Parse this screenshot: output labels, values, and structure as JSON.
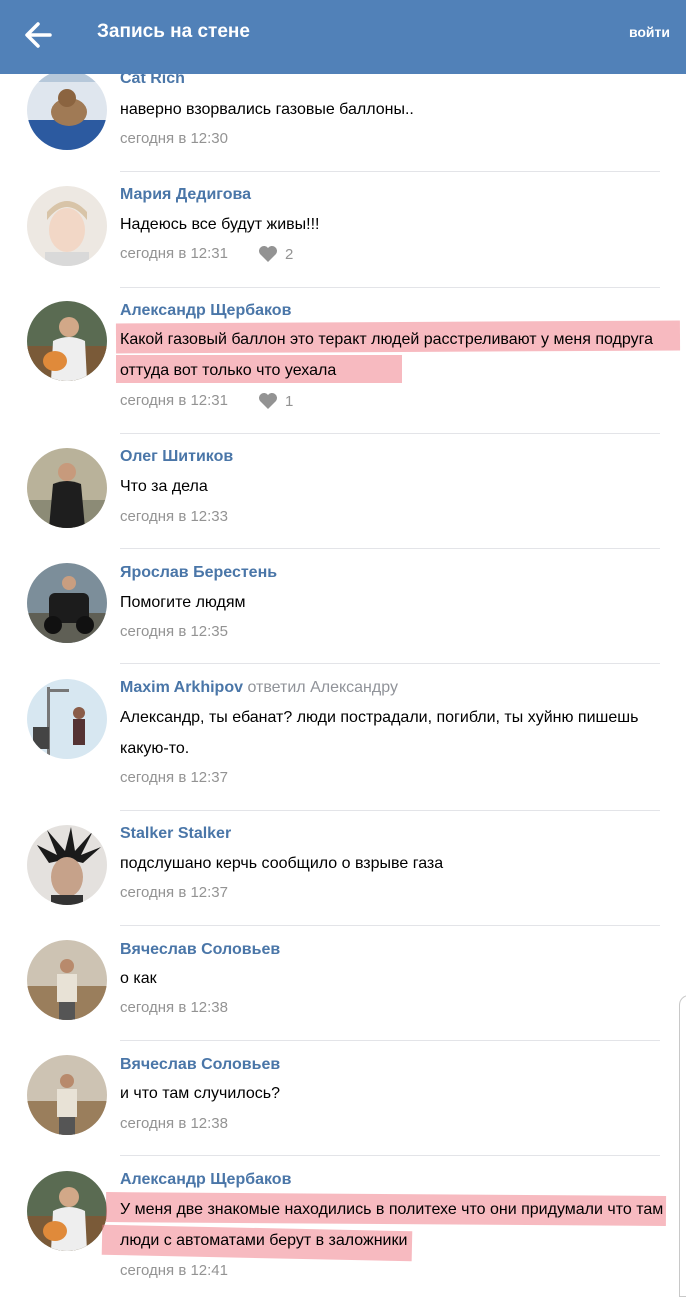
{
  "header": {
    "title": "Запись на стене",
    "login_label": "войти",
    "back_icon": "arrow-left-icon",
    "color": "#5181b8"
  },
  "comments": [
    {
      "author": "Cat Rich",
      "text": "наверно взорвались газовые баллоны..",
      "time": "сегодня в 12:30"
    },
    {
      "author": "Мария Дедигова",
      "text": "Надеюсь все будут живы!!!",
      "time": "сегодня в 12:31",
      "likes": "2"
    },
    {
      "author": "Александр Щербаков",
      "text": "Какой газовый баллон это теракт людей расстреливают у меня подруга оттуда вот только что уехала",
      "time": "сегодня в 12:31",
      "likes": "1",
      "highlighted": true
    },
    {
      "author": "Олег Шитиков",
      "text": "Что за дела",
      "time": "сегодня в 12:33"
    },
    {
      "author": "Ярослав Берестень",
      "text": "Помогите людям",
      "time": "сегодня в 12:35"
    },
    {
      "author": "Maxim Arkhipov",
      "reply_to": "ответил Александру",
      "text": "Александр, ты ебанат? люди пострадали, погибли, ты хуйню пишешь какую-то.",
      "time": "сегодня в 12:37"
    },
    {
      "author": "Stalker Stalker",
      "text": "подслушано керчь сообщило о взрыве газа",
      "time": "сегодня в 12:37"
    },
    {
      "author": "Вячеслав Соловьев",
      "text": "о как",
      "time": "сегодня в 12:38"
    },
    {
      "author": "Вячеслав Соловьев",
      "text": "и что там случилось?",
      "time": "сегодня в 12:38"
    },
    {
      "author": "Александр Щербаков",
      "text": "У меня две знакомые находились в политехе что они придумали что там люди с автоматами берут в заложники",
      "time": "сегодня в 12:41",
      "highlighted": true
    }
  ],
  "colors": {
    "link": "#4a76a8",
    "meta": "#939393",
    "highlight": "#f0828c"
  },
  "icons": {
    "like": "heart-icon"
  }
}
